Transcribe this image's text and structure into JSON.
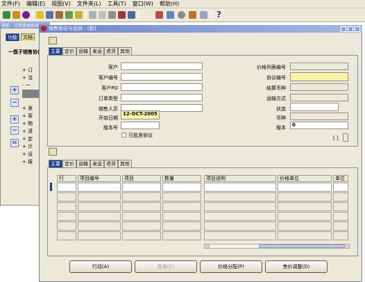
{
  "menu": [
    "文件(F)",
    "编辑(E)",
    "视图(V)",
    "文件夹(L)",
    "工具(T)",
    "窗口(W)",
    "帮助(H)"
  ],
  "toolbar_icons": [
    "new-icon",
    "open-icon",
    "stop-icon",
    "folder-icon",
    "print-icon",
    "attach-icon",
    "copy-icon",
    "cut-icon",
    "paste-icon",
    "doc-icon",
    "clear-icon",
    "delete-icon",
    "edit-icon",
    "zoom-icon",
    "translate-icon",
    "flag-icon",
    "help-icon"
  ],
  "toolbar_help": "?",
  "bg_window": {
    "title": "导航 - 订单管理系统",
    "tab_a": "功能",
    "tab_b": "文档",
    "heading": "一揽子销售协议",
    "items": [
      "+ 订",
      "+ 洽",
      "- 一",
      "+ 发",
      "+ 客",
      "+ 物",
      "+ 清",
      "+ 定",
      "+ 计",
      "+ 设",
      "+ 报"
    ]
  },
  "front_window": {
    "title": "销售协议与合同 - [新]",
    "tabs_top": [
      "主要",
      "定价",
      "运输",
      "发运",
      "退货",
      "其他"
    ],
    "form": {
      "left_labels": [
        "客户",
        "客户编号",
        "客户PO",
        "订单类型",
        "销售人员",
        "开始日期",
        "版本号"
      ],
      "left_values": [
        "",
        "",
        "",
        "",
        "",
        "12-OCT-2005",
        ""
      ],
      "checkbox_label": "已批准协议",
      "right_labels": [
        "价格列表编号",
        "协议编号",
        "结算币种",
        "运输方式",
        "状态",
        "币种",
        "版本"
      ],
      "right_values": [
        "",
        "",
        "",
        "",
        "",
        "",
        "0"
      ],
      "bracket": "[ ]"
    },
    "tabs_lines": [
      "主要",
      "定价",
      "运输",
      "发运",
      "退货",
      "其他"
    ],
    "grid_headers": [
      "行",
      "项目编号",
      "项目",
      "数量",
      "项目说明",
      "价格单位",
      "单位"
    ],
    "buttons": [
      "行动(A)",
      "批准(C)",
      "价格分配(P)",
      "售价调整(D)"
    ]
  }
}
